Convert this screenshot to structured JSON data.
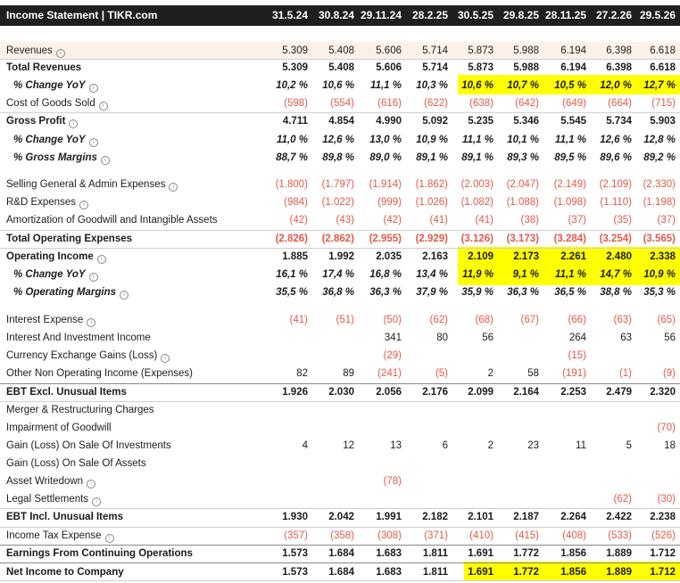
{
  "header": {
    "title": "Income Statement | TIKR.com",
    "columns": [
      "31.5.24",
      "30.8.24",
      "29.11.24",
      "28.2.25",
      "30.5.25",
      "29.8.25",
      "28.11.25",
      "27.2.26",
      "29.5.26"
    ]
  },
  "rows": [
    {
      "label": "Revenues",
      "info": true,
      "style": "normal",
      "values": [
        "5.309",
        "5.408",
        "5.606",
        "5.714",
        "5.873",
        "5.988",
        "6.194",
        "6.398",
        "6.618"
      ]
    },
    {
      "label": "Total Revenues",
      "info": false,
      "style": "bold",
      "values": [
        "5.309",
        "5.408",
        "5.606",
        "5.714",
        "5.873",
        "5.988",
        "6.194",
        "6.398",
        "6.618"
      ]
    },
    {
      "label": "% Change YoY",
      "info": true,
      "style": "italic",
      "values": [
        "10,2 %",
        "10,6 %",
        "11,1 %",
        "10,3 %",
        "10,6 %",
        "10,7 %",
        "10,5 %",
        "12,0 %",
        "12,7 %"
      ]
    },
    {
      "label": "Cost of Goods Sold",
      "info": true,
      "style": "normal",
      "values": [
        "(598)",
        "(554)",
        "(616)",
        "(622)",
        "(638)",
        "(642)",
        "(649)",
        "(664)",
        "(715)"
      ]
    },
    {
      "label": "Gross Profit",
      "info": true,
      "style": "bold",
      "values": [
        "4.711",
        "4.854",
        "4.990",
        "5.092",
        "5.235",
        "5.346",
        "5.545",
        "5.734",
        "5.903"
      ]
    },
    {
      "label": "% Change YoY",
      "info": true,
      "style": "italic",
      "values": [
        "11,0 %",
        "12,6 %",
        "13,0 %",
        "10,9 %",
        "11,1 %",
        "10,1 %",
        "11,1 %",
        "12,6 %",
        "12,8 %"
      ]
    },
    {
      "label": "% Gross Margins",
      "info": true,
      "style": "italic",
      "values": [
        "88,7 %",
        "89,8 %",
        "89,0 %",
        "89,1 %",
        "89,1 %",
        "89,3 %",
        "89,5 %",
        "89,6 %",
        "89,2 %"
      ]
    },
    {
      "label": "Selling General & Admin Expenses",
      "info": true,
      "style": "normal",
      "values": [
        "(1.800)",
        "(1.797)",
        "(1.914)",
        "(1.862)",
        "(2.003)",
        "(2.047)",
        "(2.149)",
        "(2.109)",
        "(2.330)"
      ]
    },
    {
      "label": "R&D Expenses",
      "info": true,
      "style": "normal",
      "values": [
        "(984)",
        "(1.022)",
        "(999)",
        "(1.026)",
        "(1.082)",
        "(1.088)",
        "(1.098)",
        "(1.110)",
        "(1.198)"
      ]
    },
    {
      "label": "Amortization of Goodwill and Intangible Assets",
      "info": false,
      "style": "normal",
      "values": [
        "(42)",
        "(43)",
        "(42)",
        "(41)",
        "(41)",
        "(38)",
        "(37)",
        "(35)",
        "(37)"
      ]
    },
    {
      "label": "Total Operating Expenses",
      "info": false,
      "style": "bold",
      "values": [
        "(2.826)",
        "(2.862)",
        "(2.955)",
        "(2.929)",
        "(3.126)",
        "(3.173)",
        "(3.284)",
        "(3.254)",
        "(3.565)"
      ]
    },
    {
      "label": "Operating Income",
      "info": true,
      "style": "bold",
      "values": [
        "1.885",
        "1.992",
        "2.035",
        "2.163",
        "2.109",
        "2.173",
        "2.261",
        "2.480",
        "2.338"
      ]
    },
    {
      "label": "% Change YoY",
      "info": true,
      "style": "italic",
      "values": [
        "16,1 %",
        "17,4 %",
        "16,8 %",
        "13,4 %",
        "11,9 %",
        "9,1 %",
        "11,1 %",
        "14,7 %",
        "10,9 %"
      ]
    },
    {
      "label": "% Operating Margins",
      "info": true,
      "style": "italic",
      "values": [
        "35,5 %",
        "36,8 %",
        "36,3 %",
        "37,9 %",
        "35,9 %",
        "36,3 %",
        "36,5 %",
        "38,8 %",
        "35,3 %"
      ]
    },
    {
      "label": "Interest Expense",
      "info": true,
      "style": "normal",
      "values": [
        "(41)",
        "(51)",
        "(50)",
        "(62)",
        "(68)",
        "(67)",
        "(66)",
        "(63)",
        "(65)"
      ]
    },
    {
      "label": "Interest And Investment Income",
      "info": false,
      "style": "normal",
      "values": [
        "",
        "",
        "341",
        "80",
        "56",
        "",
        "264",
        "63",
        "56"
      ]
    },
    {
      "label": "Currency Exchange Gains (Loss)",
      "info": true,
      "style": "normal",
      "values": [
        "",
        "",
        "(29)",
        "",
        "",
        "",
        "(15)",
        "",
        ""
      ]
    },
    {
      "label": "Other Non Operating Income (Expenses)",
      "info": false,
      "style": "normal",
      "values": [
        "82",
        "89",
        "(241)",
        "(5)",
        "2",
        "58",
        "(191)",
        "(1)",
        "(9)"
      ]
    },
    {
      "label": "EBT Excl. Unusual Items",
      "info": false,
      "style": "bold",
      "values": [
        "1.926",
        "2.030",
        "2.056",
        "2.176",
        "2.099",
        "2.164",
        "2.253",
        "2.479",
        "2.320"
      ]
    },
    {
      "label": "Merger & Restructuring Charges",
      "info": false,
      "style": "normal",
      "values": [
        "",
        "",
        "",
        "",
        "",
        "",
        "",
        "",
        ""
      ]
    },
    {
      "label": "Impairment of Goodwill",
      "info": false,
      "style": "normal",
      "values": [
        "",
        "",
        "",
        "",
        "",
        "",
        "",
        "",
        "(70)"
      ]
    },
    {
      "label": "Gain (Loss) On Sale Of Investments",
      "info": false,
      "style": "normal",
      "values": [
        "4",
        "12",
        "13",
        "6",
        "2",
        "23",
        "11",
        "5",
        "18"
      ]
    },
    {
      "label": "Gain (Loss) On Sale Of Assets",
      "info": false,
      "style": "normal",
      "values": [
        "",
        "",
        "",
        "",
        "",
        "",
        "",
        "",
        ""
      ]
    },
    {
      "label": "Asset Writedown",
      "info": true,
      "style": "normal",
      "values": [
        "",
        "",
        "(78)",
        "",
        "",
        "",
        "",
        "",
        ""
      ]
    },
    {
      "label": "Legal Settlements",
      "info": true,
      "style": "normal",
      "values": [
        "",
        "",
        "",
        "",
        "",
        "",
        "",
        "(62)",
        "(30)"
      ]
    },
    {
      "label": "EBT Incl. Unusual Items",
      "info": false,
      "style": "bold",
      "values": [
        "1.930",
        "2.042",
        "1.991",
        "2.182",
        "2.101",
        "2.187",
        "2.264",
        "2.422",
        "2.238"
      ]
    },
    {
      "label": "Income Tax Expense",
      "info": true,
      "style": "normal",
      "values": [
        "(357)",
        "(358)",
        "(308)",
        "(371)",
        "(410)",
        "(415)",
        "(408)",
        "(533)",
        "(526)"
      ]
    },
    {
      "label": "Earnings From Continuing Operations",
      "info": false,
      "style": "bold",
      "values": [
        "1.573",
        "1.684",
        "1.683",
        "1.811",
        "1.691",
        "1.772",
        "1.856",
        "1.889",
        "1.712"
      ]
    },
    {
      "label": "Net Income to Company",
      "info": false,
      "style": "bold",
      "values": [
        "1.573",
        "1.684",
        "1.683",
        "1.811",
        "1.691",
        "1.772",
        "1.856",
        "1.889",
        "1.712"
      ]
    }
  ],
  "colors": {
    "highlight": "#ffff00",
    "negative": "#e05b4b",
    "header_bg": "#1f1f1f"
  }
}
